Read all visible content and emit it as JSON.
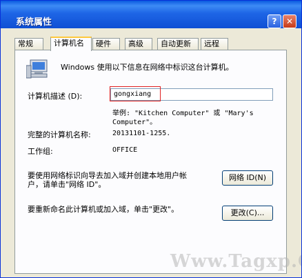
{
  "window": {
    "title": "系统属性",
    "help_glyph": "?",
    "close_glyph": "✕"
  },
  "tabs": [
    {
      "label": "常规"
    },
    {
      "label": "计算机名",
      "active": true
    },
    {
      "label": "硬件"
    },
    {
      "label": "高级"
    },
    {
      "label": "自动更新"
    },
    {
      "label": "远程"
    }
  ],
  "panel": {
    "intro_text": "Windows 使用以下信息在网络中标识这台计算机。",
    "description_label": "计算机描述 (D):",
    "description_value": "gongxiang",
    "example_line1": "举例: \"Kitchen Computer\" 或 \"Mary's",
    "example_line2": "Computer\"。",
    "full_name_label": "完整的计算机名称:",
    "full_name_value": "20131101-1255.",
    "workgroup_label": "工作组:",
    "workgroup_value": "OFFICE",
    "network_id_text1": "要使用网络标识向导去加入域并创建本地用户帐",
    "network_id_text2": "户，请单击\"网络 ID\"。",
    "network_id_button": "网络 ID(N)",
    "rename_text": "要重新命名此计算机或加入域，单击\"更改\"。",
    "change_button": "更改(C)..."
  },
  "watermark": "Www.Tagxp.Com",
  "icons": {
    "computer": "computer-icon"
  },
  "colors": {
    "titlebar": "#0f50d4",
    "highlight_box": "#e02020",
    "active_tab_accent": "#ffc83c"
  }
}
